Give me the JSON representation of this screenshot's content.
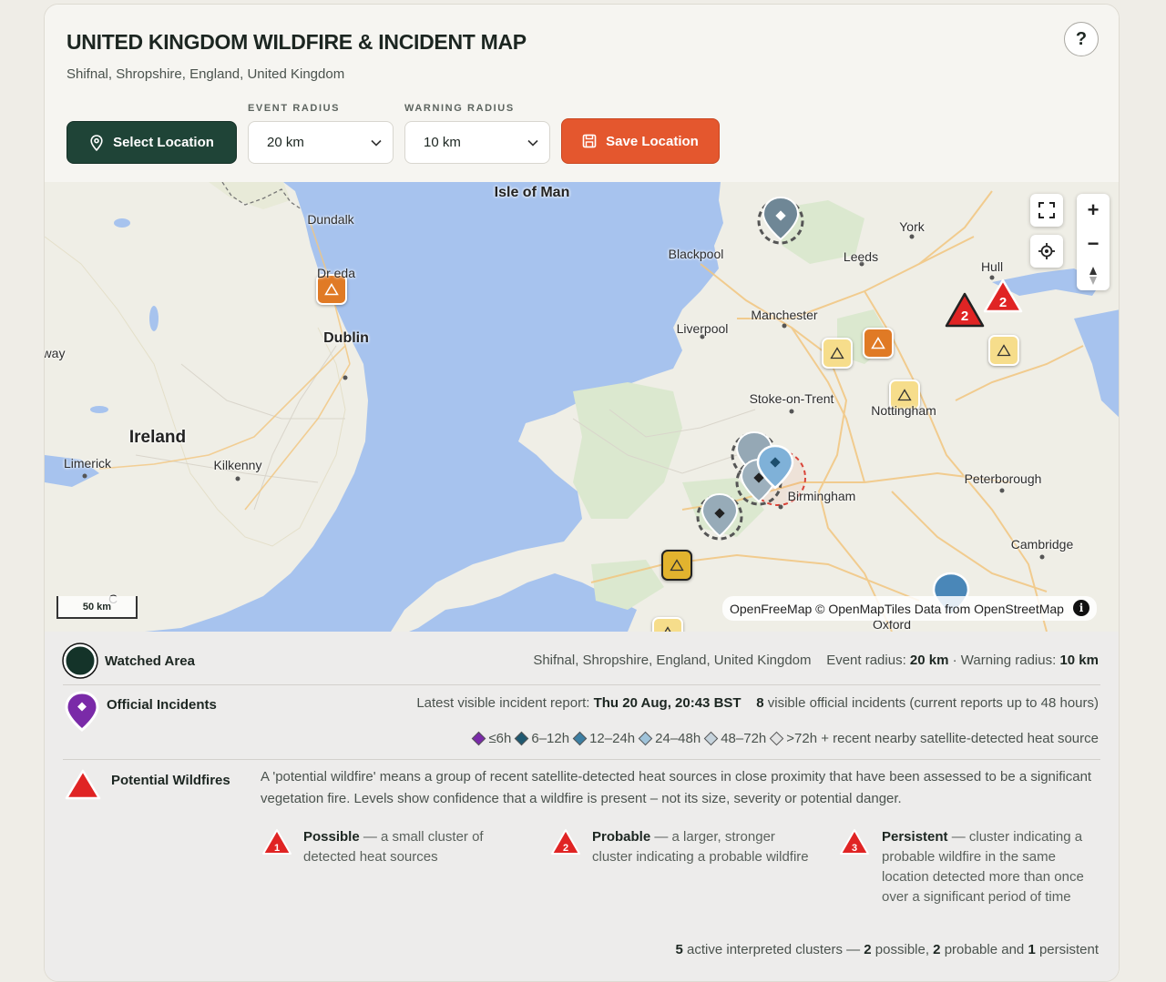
{
  "header": {
    "title": "UNITED KINGDOM WILDFIRE & INCIDENT MAP",
    "subtitle": "Shifnal, Shropshire, England, United Kingdom",
    "help_label": "?",
    "select_location_label": "Select Location",
    "event_radius_label": "EVENT RADIUS",
    "event_radius_value": "20 km",
    "warning_radius_label": "WARNING RADIUS",
    "warning_radius_value": "10 km",
    "save_location_label": "Save Location"
  },
  "map": {
    "places": {
      "isle_of_man": "Isle of Man",
      "dundalk": "Dundalk",
      "drogheda": "Dr    eda",
      "dublin": "Dublin",
      "ireland": "Ireland",
      "limerick": "Limerick",
      "kilkenny": "Kilkenny",
      "way": "way",
      "blackpool": "Blackpool",
      "york": "York",
      "leeds": "Leeds",
      "hull": "Hull",
      "manchester": "Manchester",
      "liverpool": "Liverpool",
      "stoke": "Stoke-on-Trent",
      "nottingham": "Nottingham",
      "peterborough": "Peterborough",
      "birmingham": "Birmingham",
      "cambridge": "Cambridge",
      "oxford": "Oxford",
      "cork": "C"
    },
    "scale_label": "50 km",
    "attribution": "OpenFreeMap © OpenMapTiles Data from OpenStreetMap",
    "cluster_count_a": "2",
    "cluster_count_b": "2",
    "controls": {
      "fullscreen_icon": "fullscreen-icon",
      "zoom_in": "+",
      "zoom_out": "−",
      "locate_icon": "locate-icon",
      "compass_icon": "compass-icon"
    }
  },
  "legend": {
    "watched_area": {
      "label": "Watched Area",
      "location": "Shifnal, Shropshire, England, United Kingdom",
      "event_radius_prefix": "Event radius:",
      "event_radius": "20 km",
      "warning_radius_prefix": "· Warning radius:",
      "warning_radius": "10 km"
    },
    "official_incidents": {
      "label": "Official Incidents",
      "latest_prefix": "Latest visible incident report:",
      "latest_value": "Thu 20 Aug, 20:43 BST",
      "count": "8",
      "count_suffix": "visible official incidents (current reports up to 48 hours)",
      "ages": [
        "≤6h",
        "6–12h",
        "12–24h",
        "24–48h",
        "48–72h",
        ">72h + recent nearby satellite-detected heat source"
      ],
      "age_colors": [
        "#7a2aa8",
        "#1f5870",
        "#3d7fa3",
        "#9fc3da",
        "#c6d3dc",
        "#e4e4e4"
      ]
    },
    "potential_wildfires": {
      "label": "Potential Wildfires",
      "description": "A 'potential wildfire' means a group of recent satellite-detected heat sources in close proximity that have been assessed to be a significant vegetation fire. Levels show confidence that a wildfire is present – not its size, severity or potential danger.",
      "levels": [
        {
          "num": "1",
          "name": "Possible",
          "text": "— a small cluster of detected heat sources"
        },
        {
          "num": "2",
          "name": "Probable",
          "text": "— a larger, stronger cluster indicating a probable wildfire"
        },
        {
          "num": "3",
          "name": "Persistent",
          "text": "— cluster indicating a probable wildfire in the same location detected more than once over a significant period of time"
        }
      ],
      "summary_count": "5",
      "summary_text": "active interpreted clusters —",
      "possible_count": "2",
      "possible_text": "possible,",
      "probable_count": "2",
      "probable_text": "probable and",
      "persistent_count": "1",
      "persistent_text": "persistent"
    }
  },
  "colors": {
    "primary": "#1f4437",
    "accent": "#e4572e",
    "sea": "#a7c3ee",
    "land": "#efeee6",
    "wildfire_red": "#e02424"
  }
}
